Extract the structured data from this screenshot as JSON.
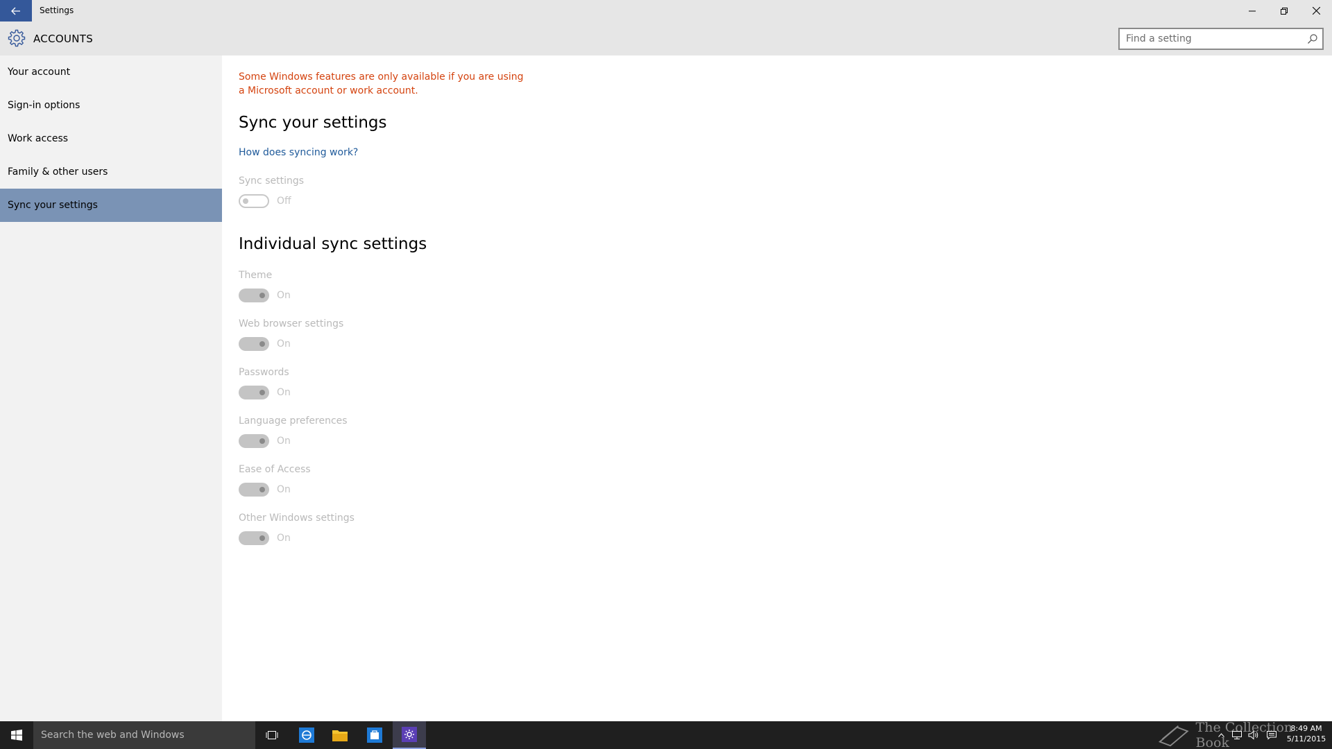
{
  "window": {
    "title": "Settings",
    "back_icon": "arrow-left-icon",
    "minimize_icon": "minimize-icon",
    "restore_icon": "restore-icon",
    "close_icon": "close-icon"
  },
  "header": {
    "icon": "gear-icon",
    "title": "ACCOUNTS",
    "search_placeholder": "Find a setting"
  },
  "sidebar": {
    "items": [
      {
        "label": "Your account"
      },
      {
        "label": "Sign-in options"
      },
      {
        "label": "Work access"
      },
      {
        "label": "Family & other users"
      },
      {
        "label": "Sync your settings",
        "selected": true
      }
    ]
  },
  "main": {
    "warning": "Some Windows features are only available if you are using a Microsoft account or work account.",
    "sync_heading": "Sync your settings",
    "how_link": "How does syncing work?",
    "sync_settings": {
      "label": "Sync settings",
      "state": "Off"
    },
    "individual_heading": "Individual sync settings",
    "individual": [
      {
        "label": "Theme",
        "state": "On"
      },
      {
        "label": "Web browser settings",
        "state": "On"
      },
      {
        "label": "Passwords",
        "state": "On"
      },
      {
        "label": "Language preferences",
        "state": "On"
      },
      {
        "label": "Ease of Access",
        "state": "On"
      },
      {
        "label": "Other Windows settings",
        "state": "On"
      }
    ]
  },
  "taskbar": {
    "search_text": "Search the web and Windows",
    "apps": [
      "task-view-icon",
      "internet-explorer-icon",
      "file-explorer-icon",
      "store-icon",
      "settings-icon"
    ],
    "watermark": "The Collection Book",
    "time": "8:49 AM",
    "date": "5/11/2015"
  },
  "colors": {
    "titlebar": "#e6e6e6",
    "back_button": "#34589a",
    "sidebar": "#f2f2f2",
    "selected_nav": "#7a93b5",
    "warning_text": "#d4430f",
    "link": "#1f5a9a",
    "taskbar": "#1f1f1f"
  }
}
